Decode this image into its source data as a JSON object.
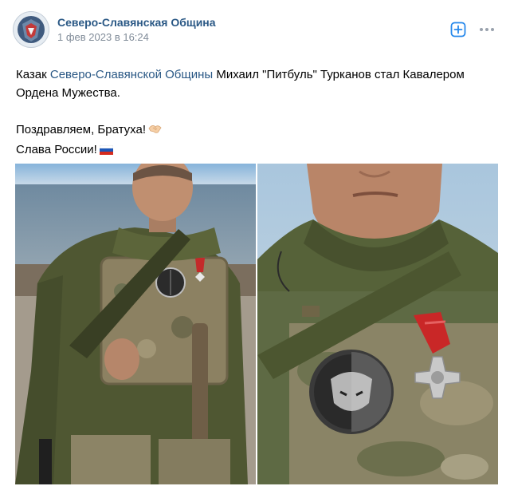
{
  "header": {
    "avatar_icon": "community-emblem-icon",
    "group_name": "Северо-Славянская Община",
    "date": "1 фев 2023 в 16:24",
    "add_icon": "plus-square-icon",
    "more_icon": "more-horizontal-icon"
  },
  "post": {
    "line1_prefix": "Казак ",
    "line1_mention": "Северо-Славянской Общины",
    "line1_suffix": " Михаил \"Питбуль\" Турканов стал Кавалером",
    "line2": "Ордена Мужества.",
    "line3": "Поздравляем, Братуха!",
    "line3_emoji": "handshake-emoji",
    "line4": "Слава России!",
    "line4_emoji": "russian-flag-emoji"
  },
  "photos": [
    {
      "name": "photo-soldier-seaside",
      "subject": "soldier-in-camouflage-with-medal"
    },
    {
      "name": "photo-medal-closeup",
      "subject": "pitbull-patch-and-order-of-courage"
    }
  ],
  "colors": {
    "link": "#2a5885",
    "meta": "#818c99",
    "accent": "#2688eb"
  }
}
